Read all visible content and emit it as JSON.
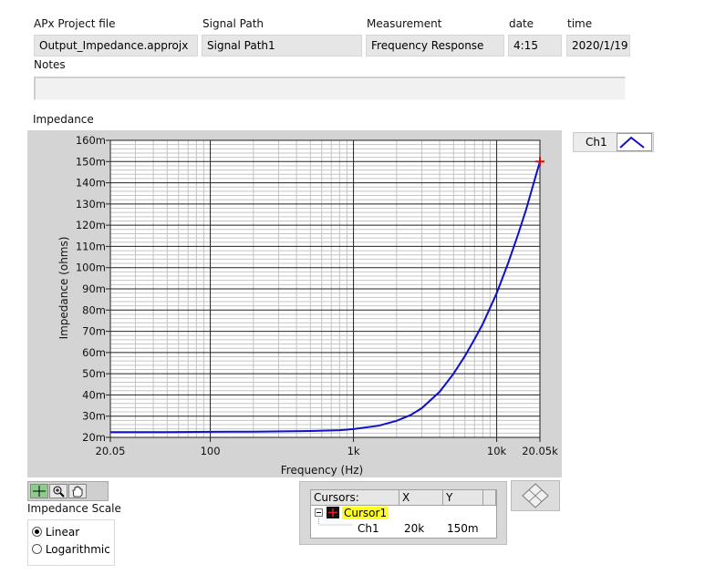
{
  "header": {
    "project_label": "APx Project file",
    "project_value": "Output_Impedance.approjx",
    "signal_path_label": "Signal Path",
    "signal_path_value": "Signal Path1",
    "measurement_label": "Measurement",
    "measurement_value": "Frequency Response",
    "date_label": "date",
    "date_value": "4:15",
    "time_label": "time",
    "time_value": "2020/1/19",
    "notes_label": "Notes",
    "notes_value": ""
  },
  "graph": {
    "section_label": "Impedance",
    "legend_label": "Ch1",
    "line_color": "#1010c8",
    "cursor_color": "#c81010"
  },
  "chart_data": {
    "type": "line",
    "xlabel": "Frequency (Hz)",
    "ylabel": "Impedance (ohms)",
    "xscale": "log",
    "xlim": [
      20.05,
      20050
    ],
    "ylim": [
      20,
      160
    ],
    "grid": true,
    "x_ticks": [
      {
        "value": 20.05,
        "label": "20.05"
      },
      {
        "value": 100,
        "label": "100"
      },
      {
        "value": 1000,
        "label": "1k"
      },
      {
        "value": 10000,
        "label": "10k"
      },
      {
        "value": 20050,
        "label": "20.05k"
      }
    ],
    "y_ticks": [
      {
        "value": 20,
        "label": "20m"
      },
      {
        "value": 30,
        "label": "30m"
      },
      {
        "value": 40,
        "label": "40m"
      },
      {
        "value": 50,
        "label": "50m"
      },
      {
        "value": 60,
        "label": "60m"
      },
      {
        "value": 70,
        "label": "70m"
      },
      {
        "value": 80,
        "label": "80m"
      },
      {
        "value": 90,
        "label": "90m"
      },
      {
        "value": 100,
        "label": "100m"
      },
      {
        "value": 110,
        "label": "110m"
      },
      {
        "value": 120,
        "label": "120m"
      },
      {
        "value": 130,
        "label": "130m"
      },
      {
        "value": 140,
        "label": "140m"
      },
      {
        "value": 150,
        "label": "150m"
      },
      {
        "value": 160,
        "label": "160m"
      }
    ],
    "series": [
      {
        "name": "Ch1",
        "x": [
          20.05,
          50,
          100,
          200,
          500,
          800,
          1000,
          1500,
          2000,
          2500,
          3000,
          4000,
          5000,
          6000,
          7000,
          8000,
          10000,
          12000,
          14000,
          16000,
          18000,
          20050
        ],
        "y": [
          22.5,
          22.5,
          22.6,
          22.7,
          23,
          23.4,
          23.9,
          25.5,
          27.8,
          30.5,
          33.8,
          41.5,
          50,
          58.3,
          66.2,
          73.5,
          88,
          102,
          115,
          127,
          139,
          150
        ]
      }
    ]
  },
  "controls": {
    "scale_label": "Impedance Scale",
    "linear_label": "Linear",
    "log_label": "Logarithmic",
    "selected": "Linear"
  },
  "cursors": {
    "header_cursors": "Cursors:",
    "header_x": "X",
    "header_y": "Y",
    "cursor_name": "Cursor1",
    "channel": "Ch1",
    "x_value": "20k",
    "y_value": "150m"
  }
}
